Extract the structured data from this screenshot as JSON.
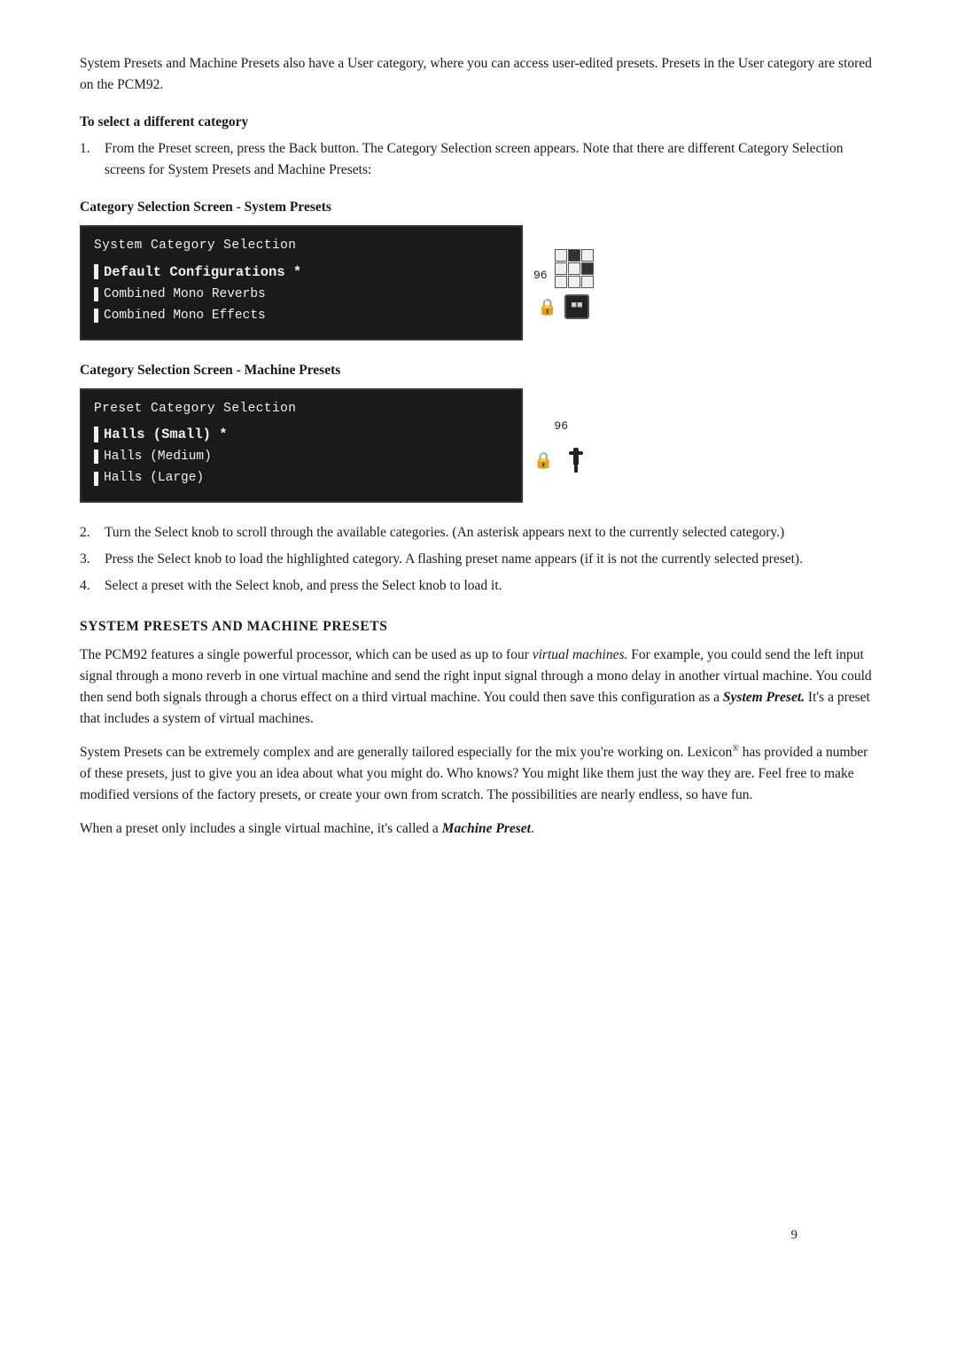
{
  "intro": {
    "para": "System Presets and Machine Presets also have a User category, where you can access user-edited presets. Presets in the User category are stored on the PCM92."
  },
  "select_category": {
    "heading": "To select a different category",
    "steps": [
      {
        "num": "1.",
        "text": "From the Preset screen, press the Back button. The Category Selection screen appears. Note that there are different Category Selection screens for System Presets and Machine Presets:"
      },
      {
        "num": "2.",
        "text": "Turn the Select knob to scroll through the available categories. (An asterisk appears next to the currently selected category.)"
      },
      {
        "num": "3.",
        "text": "Press the Select knob to load the highlighted category. A flashing preset name appears (if it is not the currently selected preset)."
      },
      {
        "num": "4.",
        "text": "Select a preset with the Select knob, and press the Select knob to load it."
      }
    ]
  },
  "screen1": {
    "label": "Category Selection Screen - System Presets",
    "title": "System Category Selection",
    "row1": "Default Configurations *",
    "row2": "Combined Mono Reverbs",
    "row3": "Combined Mono Effects",
    "side_number": "96"
  },
  "screen2": {
    "label": "Category Selection Screen - Machine Presets",
    "title": "Preset Category Selection",
    "row1": "Halls (Small)  *",
    "row2": "Halls (Medium)",
    "row3": "Halls (Large)",
    "side_number": "96"
  },
  "system_presets_section": {
    "heading": "System Presets and Machine Presets",
    "para1": "The PCM92 features a single powerful processor, which can be used as up to four virtual machines. For example, you could send the left input signal through a mono reverb in one virtual machine and send the right input signal through a mono delay in another virtual machine. You could then send both signals through a chorus effect on a third virtual machine. You could then save this configuration as a System Preset. It’s a preset that includes a system of virtual machines.",
    "para2_before": "System Presets can be extremely complex and are generally tailored especially for the mix you’re working on.  Lexicon",
    "para2_reg": "®",
    "para2_after": " has provided a number of these presets, just to give you an idea about what you might do.  Who knows? You might like them just the way they are.  Feel free to make modified versions of the factory presets, or create your own from scratch.  The possibilities are nearly endless, so have fun.",
    "para3_before": "When a preset only includes a single virtual machine, it’s called a ",
    "para3_bold_italic": "Machine Preset",
    "para3_after": "."
  },
  "page_number": "9"
}
